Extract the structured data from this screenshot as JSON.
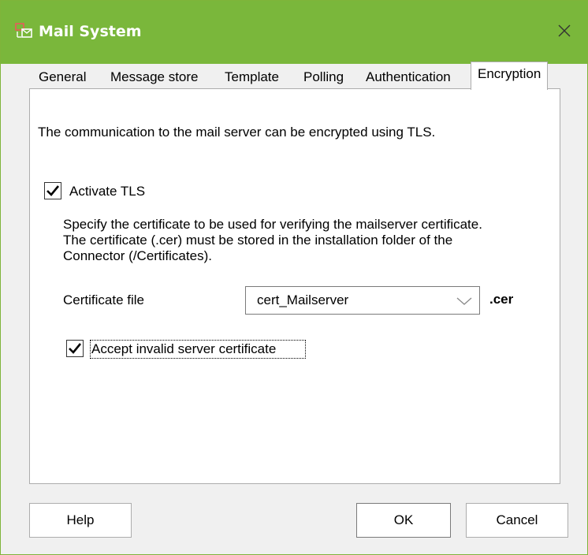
{
  "window": {
    "title": "Mail System"
  },
  "tabs": [
    "General",
    "Message store",
    "Template",
    "Polling",
    "Authentication",
    "Encryption"
  ],
  "active_tab": "Encryption",
  "panel": {
    "intro_text": "The communication to the mail server can be encrypted using TLS.",
    "activate_tls": {
      "label": "Activate TLS",
      "checked": true
    },
    "description_lines": [
      "Specify the certificate to be used for verifying the mailserver certificate.",
      "The certificate (.cer) must be stored in the installation folder of the",
      "Connector (/Certificates)."
    ],
    "certificate_file": {
      "label": "Certificate file",
      "value": "cert_Mailserver",
      "extension": ".cer"
    },
    "accept_invalid": {
      "label": "Accept invalid server certificate",
      "checked": true
    }
  },
  "buttons": {
    "help": "Help",
    "ok": "OK",
    "cancel": "Cancel"
  },
  "colors": {
    "titlebar": "#7ab73b",
    "window_bg": "#f0f0f0",
    "panel_bg": "#ffffff",
    "border": "#adadad"
  },
  "icons": {
    "app": "mail-system-icon",
    "close": "close-icon",
    "dropdown": "chevron-down-icon",
    "check": "checkmark-icon"
  }
}
